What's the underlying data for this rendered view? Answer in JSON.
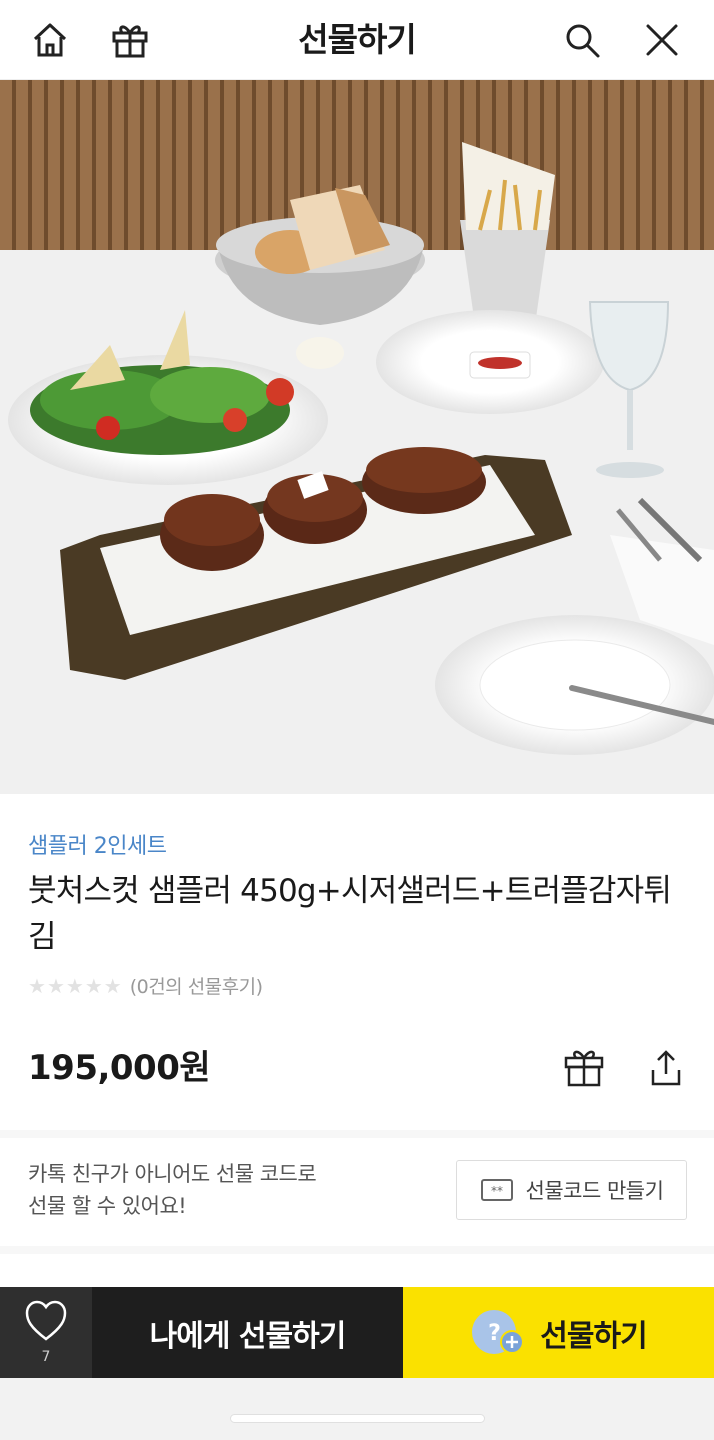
{
  "header": {
    "title": "선물하기",
    "icons": [
      "home-icon",
      "gift-icon",
      "search-icon",
      "close-icon"
    ]
  },
  "product": {
    "category": "샘플러 2인세트",
    "name": "붓처스컷 샘플러 450g+시저샐러드+트러플감자튀김",
    "rating_stars": 0,
    "rating_max": 5,
    "review_count_text": "(0건의 선물후기)",
    "price": "195,000원"
  },
  "gift_code": {
    "line1": "카톡 친구가 아니어도 선물 코드로",
    "line2": "선물 할 수 있어요!",
    "button_label": "선물코드 만들기"
  },
  "bottom_bar": {
    "wish_count": "7",
    "self_gift_label": "나에게 선물하기",
    "gift_label": "선물하기"
  },
  "colors": {
    "accent_yellow": "#fae100",
    "dark": "#1e1e1e",
    "category_blue": "#4a86c8"
  }
}
